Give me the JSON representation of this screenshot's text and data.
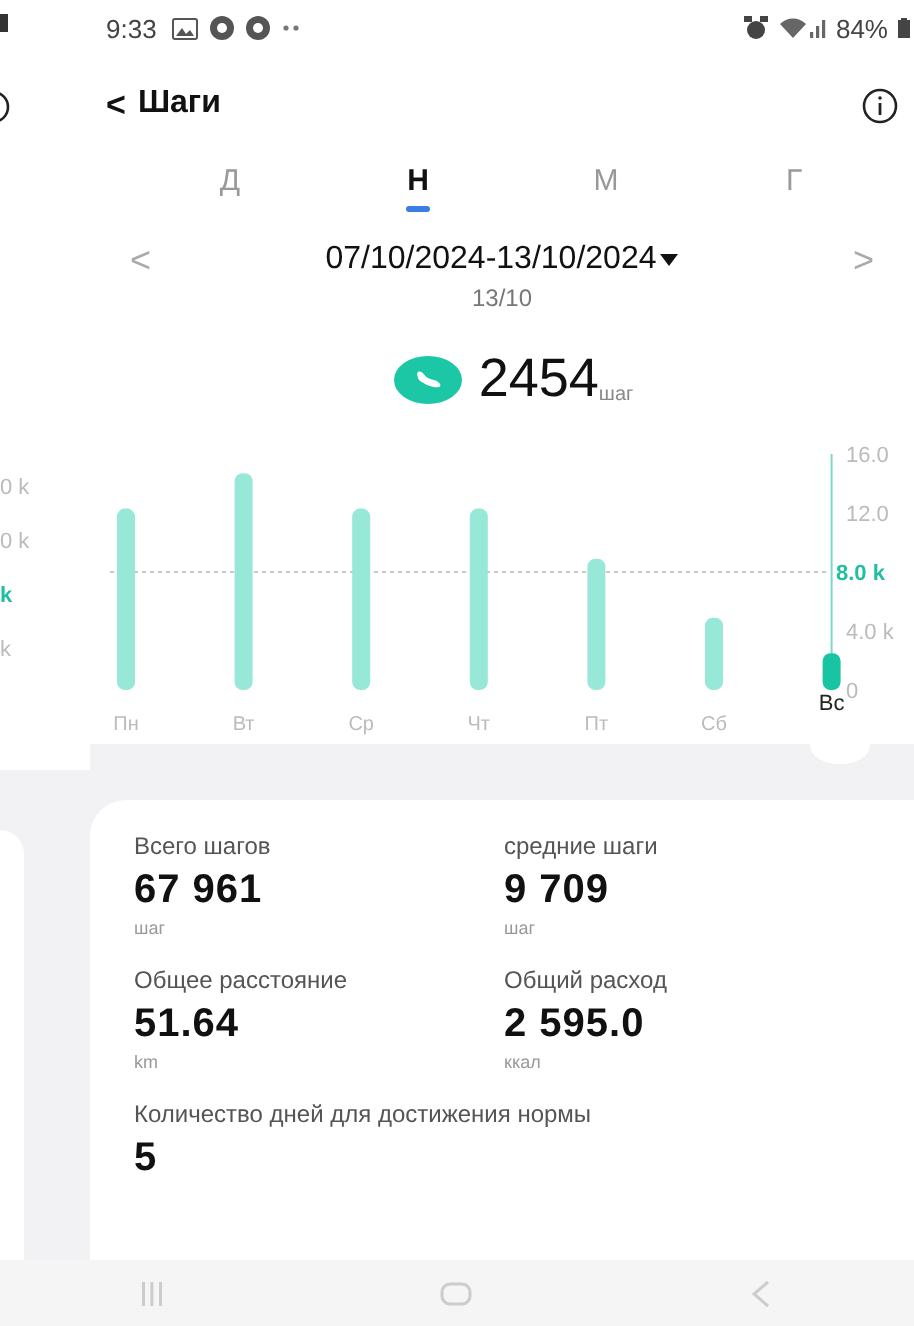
{
  "previous_page": {
    "axis_labels": [
      {
        "text": "0 k",
        "highlight": false
      },
      {
        "text": "0 k",
        "highlight": false
      },
      {
        "text": "k",
        "highlight": true
      },
      {
        "text": "k",
        "highlight": false
      }
    ]
  },
  "status_bar": {
    "time": "9:33",
    "battery": "84%"
  },
  "header": {
    "back": "<",
    "title": "Шаги"
  },
  "tabs": [
    {
      "label": "Д",
      "selected": false
    },
    {
      "label": "Н",
      "selected": true
    },
    {
      "label": "М",
      "selected": false
    },
    {
      "label": "Г",
      "selected": false
    }
  ],
  "date_nav": {
    "prev": "<",
    "range": "07/10/2024-13/10/2024",
    "next": ">",
    "selected_date": "13/10"
  },
  "total": {
    "value": "2454",
    "unit": "шаг"
  },
  "chart": {
    "day_selected": [
      false,
      false,
      false,
      false,
      false,
      false,
      true
    ],
    "chart_data": {
      "type": "bar",
      "categories": [
        "Пн",
        "Вт",
        "Ср",
        "Чт",
        "Пт",
        "Сб",
        "Вс"
      ],
      "values": [
        12.3,
        14.7,
        12.3,
        12.3,
        8.9,
        4.9,
        2.5
      ],
      "ylim": [
        0,
        16
      ],
      "yticks": [
        {
          "value": 0,
          "label": "0"
        },
        {
          "value": 4,
          "label": "4.0 k"
        },
        {
          "value": 12,
          "label": "12.0"
        },
        {
          "value": 16,
          "label": "16.0"
        }
      ],
      "ref_lines": [
        {
          "axis": "y",
          "value": 8,
          "label": "8.0 k"
        }
      ]
    }
  },
  "stats": [
    {
      "label": "Всего шагов",
      "value": "67 961",
      "unit": "шаг"
    },
    {
      "label": "средние шаги",
      "value": "9 709",
      "unit": "шаг"
    },
    {
      "label": "Общее расстояние",
      "value": "51.64",
      "unit": "km"
    },
    {
      "label": "Общий расход",
      "value": "2 595.0",
      "unit": "ккал"
    },
    {
      "label": "Количество дней для достижения нормы",
      "value": "5"
    }
  ]
}
